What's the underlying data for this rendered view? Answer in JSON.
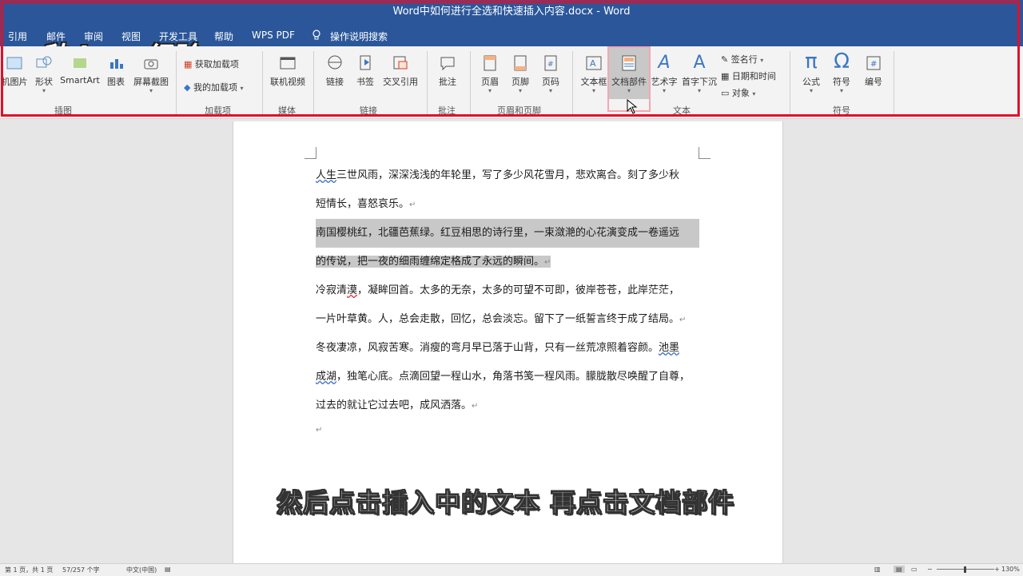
{
  "window": {
    "title": "Word中如何进行全选和快速插入内容.docx  -  Word"
  },
  "menu": {
    "tabs": [
      "引用",
      "邮件",
      "审阅",
      "视图",
      "开发工具",
      "帮助",
      "WPS PDF"
    ],
    "tellme": "操作说明搜索"
  },
  "watermark": "秒dong经验",
  "ribbon": {
    "illustrations": {
      "pictures": "机图片",
      "shapes": "形状",
      "smartart": "SmartArt",
      "chart": "图表",
      "screenshot": "屏幕截图",
      "group": "插图"
    },
    "addins": {
      "get": "获取加载项",
      "my": "我的加载项",
      "group": "加载项"
    },
    "media": {
      "video": "联机视频",
      "group": "媒体"
    },
    "links": {
      "link": "链接",
      "bookmark": "书签",
      "crossref": "交叉引用",
      "group": "链接"
    },
    "comments": {
      "comment": "批注",
      "group": "批注"
    },
    "headerfooter": {
      "header": "页眉",
      "footer": "页脚",
      "pagenum": "页码",
      "group": "页眉和页脚"
    },
    "text": {
      "textbox": "文本框",
      "quickparts": "文档部件",
      "wordart": "艺术字",
      "dropcap": "首字下沉",
      "signature": "签名行",
      "datetime": "日期和时间",
      "object": "对象",
      "group": "文本"
    },
    "symbols": {
      "equation": "公式",
      "symbol": "符号",
      "number": "编号",
      "group": "符号"
    }
  },
  "document": {
    "p1_link": "人生",
    "p1_a": "三世风雨，深深浅浅的年轮里，写了多少风花雪月，悲欢离合。刻了多少秋",
    "p1_b": "短情长，喜怒哀乐。",
    "p2_a": "南国樱桃红，北疆芭蕉绿。红豆相思的诗行里，一束潋滟的心花演变成一卷遥远",
    "p2_b": "的传说，把一夜的细雨缠绵定格成了永远的瞬间。",
    "p3_a": "冷寂清",
    "p3_b": "漠",
    "p3_c": "，凝眸回首。太多的无奈，太多的可望不可即，彼岸苍苍，此岸茫茫，",
    "p3_d": "一片叶草黄。人，总会走散，回忆，总会淡忘。留下了一纸誓言终于成了结局。",
    "p4_a": "冬夜凄凉，风寂苦寒。消瘦的弯月早已落于山背，只有一丝荒凉照着容颜。",
    "p4_b": "池墨",
    "p4_c": "成湖",
    "p4_d": "，独笔心底。点滴回望一程山水，角落书笺一程风雨。朦胧散尽唤醒了自尊，",
    "p4_e": "过去的就让它过去吧，成风洒落。",
    "mark": "↵"
  },
  "subtitle": "然后点击插入中的文本  再点击文档部件",
  "status": {
    "page": "第 1 页，共 1 页",
    "words": "57/257 个字",
    "lang": "中文(中国)",
    "zoom": "130%"
  },
  "colors": {
    "accent": "#2b579a",
    "highlight": "#e0102a"
  }
}
